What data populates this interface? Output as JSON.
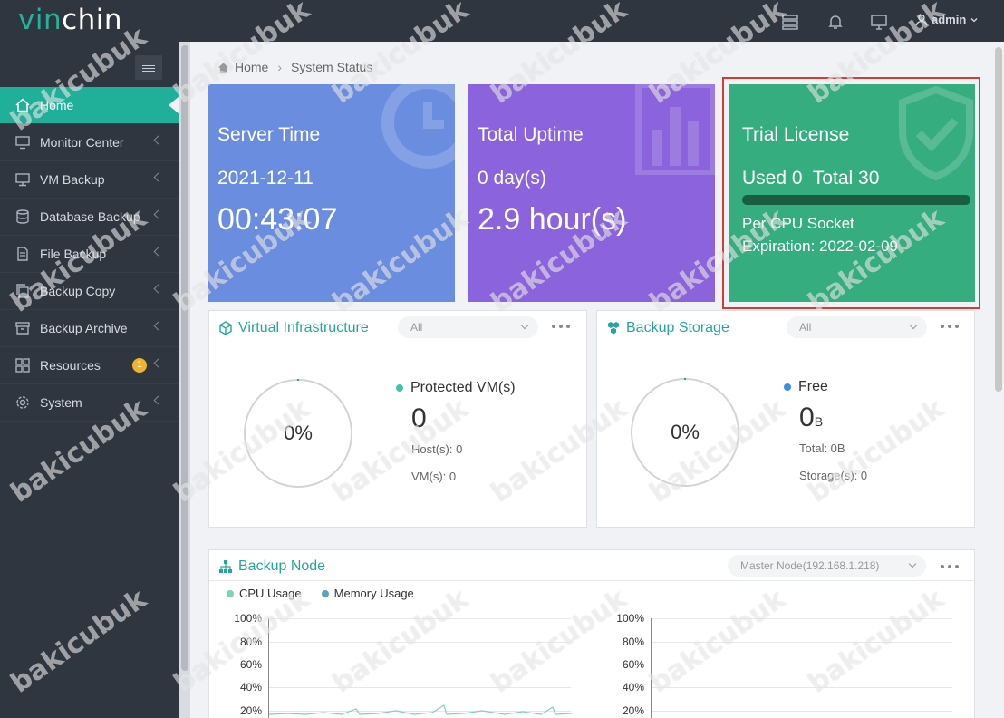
{
  "brand": {
    "logo_v": "vin",
    "logo_c": "chin"
  },
  "header": {
    "user": "admin"
  },
  "sidebar": {
    "items": [
      {
        "label": "Home"
      },
      {
        "label": "Monitor Center"
      },
      {
        "label": "VM Backup"
      },
      {
        "label": "Database Backup"
      },
      {
        "label": "File Backup"
      },
      {
        "label": "Backup Copy"
      },
      {
        "label": "Backup Archive"
      },
      {
        "label": "Resources",
        "badge": "1"
      },
      {
        "label": "System"
      }
    ]
  },
  "breadcrumb": {
    "home": "Home",
    "current": "System Status"
  },
  "cards": {
    "server_time": {
      "title": "Server Time",
      "date": "2021-12-11",
      "time": "00:43:07",
      "color": "#6b8de0"
    },
    "uptime": {
      "title": "Total Uptime",
      "days": "0 day(s)",
      "hours": "2.9 hour(s)",
      "color": "#8b63dc"
    },
    "license": {
      "title": "Trial License",
      "usage": "Used 0  Total 30",
      "type": "Per CPU Socket",
      "expiration": "Expiration: 2022-02-09",
      "color": "#35ad7f"
    }
  },
  "virtual_infra": {
    "title": "Virtual Infrastructure",
    "filter": "All",
    "percent": "0%",
    "label": "Protected VM(s)",
    "count": "0",
    "hosts": "Host(s): 0",
    "vms": "VM(s): 0"
  },
  "backup_storage": {
    "title": "Backup Storage",
    "filter": "All",
    "percent": "0%",
    "label": "Free",
    "value": "0",
    "unit": "B",
    "total": "Total: 0B",
    "storages": "Storage(s): 0"
  },
  "backup_node": {
    "title": "Backup Node",
    "node": "Master Node(192.168.1.218)",
    "legend_cpu": "CPU Usage",
    "legend_mem": "Memory Usage",
    "ticks": [
      "100%",
      "80%",
      "60%",
      "40%",
      "20%"
    ]
  },
  "watermark": "bakicubuk"
}
